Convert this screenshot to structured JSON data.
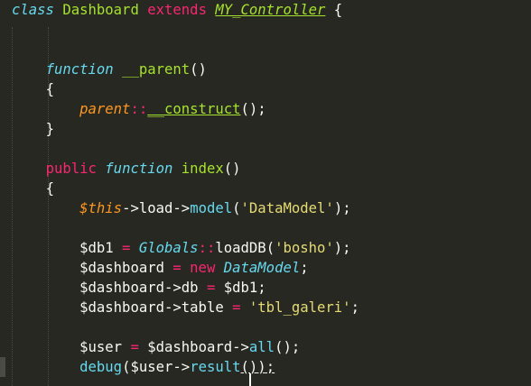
{
  "code": {
    "class_kw": "class",
    "class_name": "Dashboard",
    "extends_kw": "extends",
    "parent_class": "MY_Controller",
    "open_brace": " {",
    "function_kw": "function",
    "constructor_name": "__parent",
    "parens_empty": "()",
    "brace_open": "{",
    "brace_close": "}",
    "parent_kw": "parent",
    "scope_op": "::",
    "construct_call": "__construct",
    "call_end": "();",
    "public_kw": "public",
    "index_name": "index",
    "this_kw": "$this",
    "arrow": "->",
    "load": "load",
    "model": "model",
    "paren_open": "(",
    "str_datamodel": "'DataModel'",
    "paren_close_semi": ");",
    "var_db1": "$db1",
    "assign": " = ",
    "globals_cls": "Globals",
    "loaddb": "loadDB",
    "str_bosho": "'bosho'",
    "var_dashboard": "$dashboard",
    "new_kw": "new",
    "datamodel_cls": "DataModel",
    "semi": ";",
    "db_prop": "db",
    "db1_end": "$db1;",
    "table_prop": "table",
    "str_tbl": "'tbl_galeri'",
    "var_user": "$user",
    "all_call": "all",
    "debug_fn": "debug",
    "result_call": "result",
    "debug_end": "));"
  }
}
